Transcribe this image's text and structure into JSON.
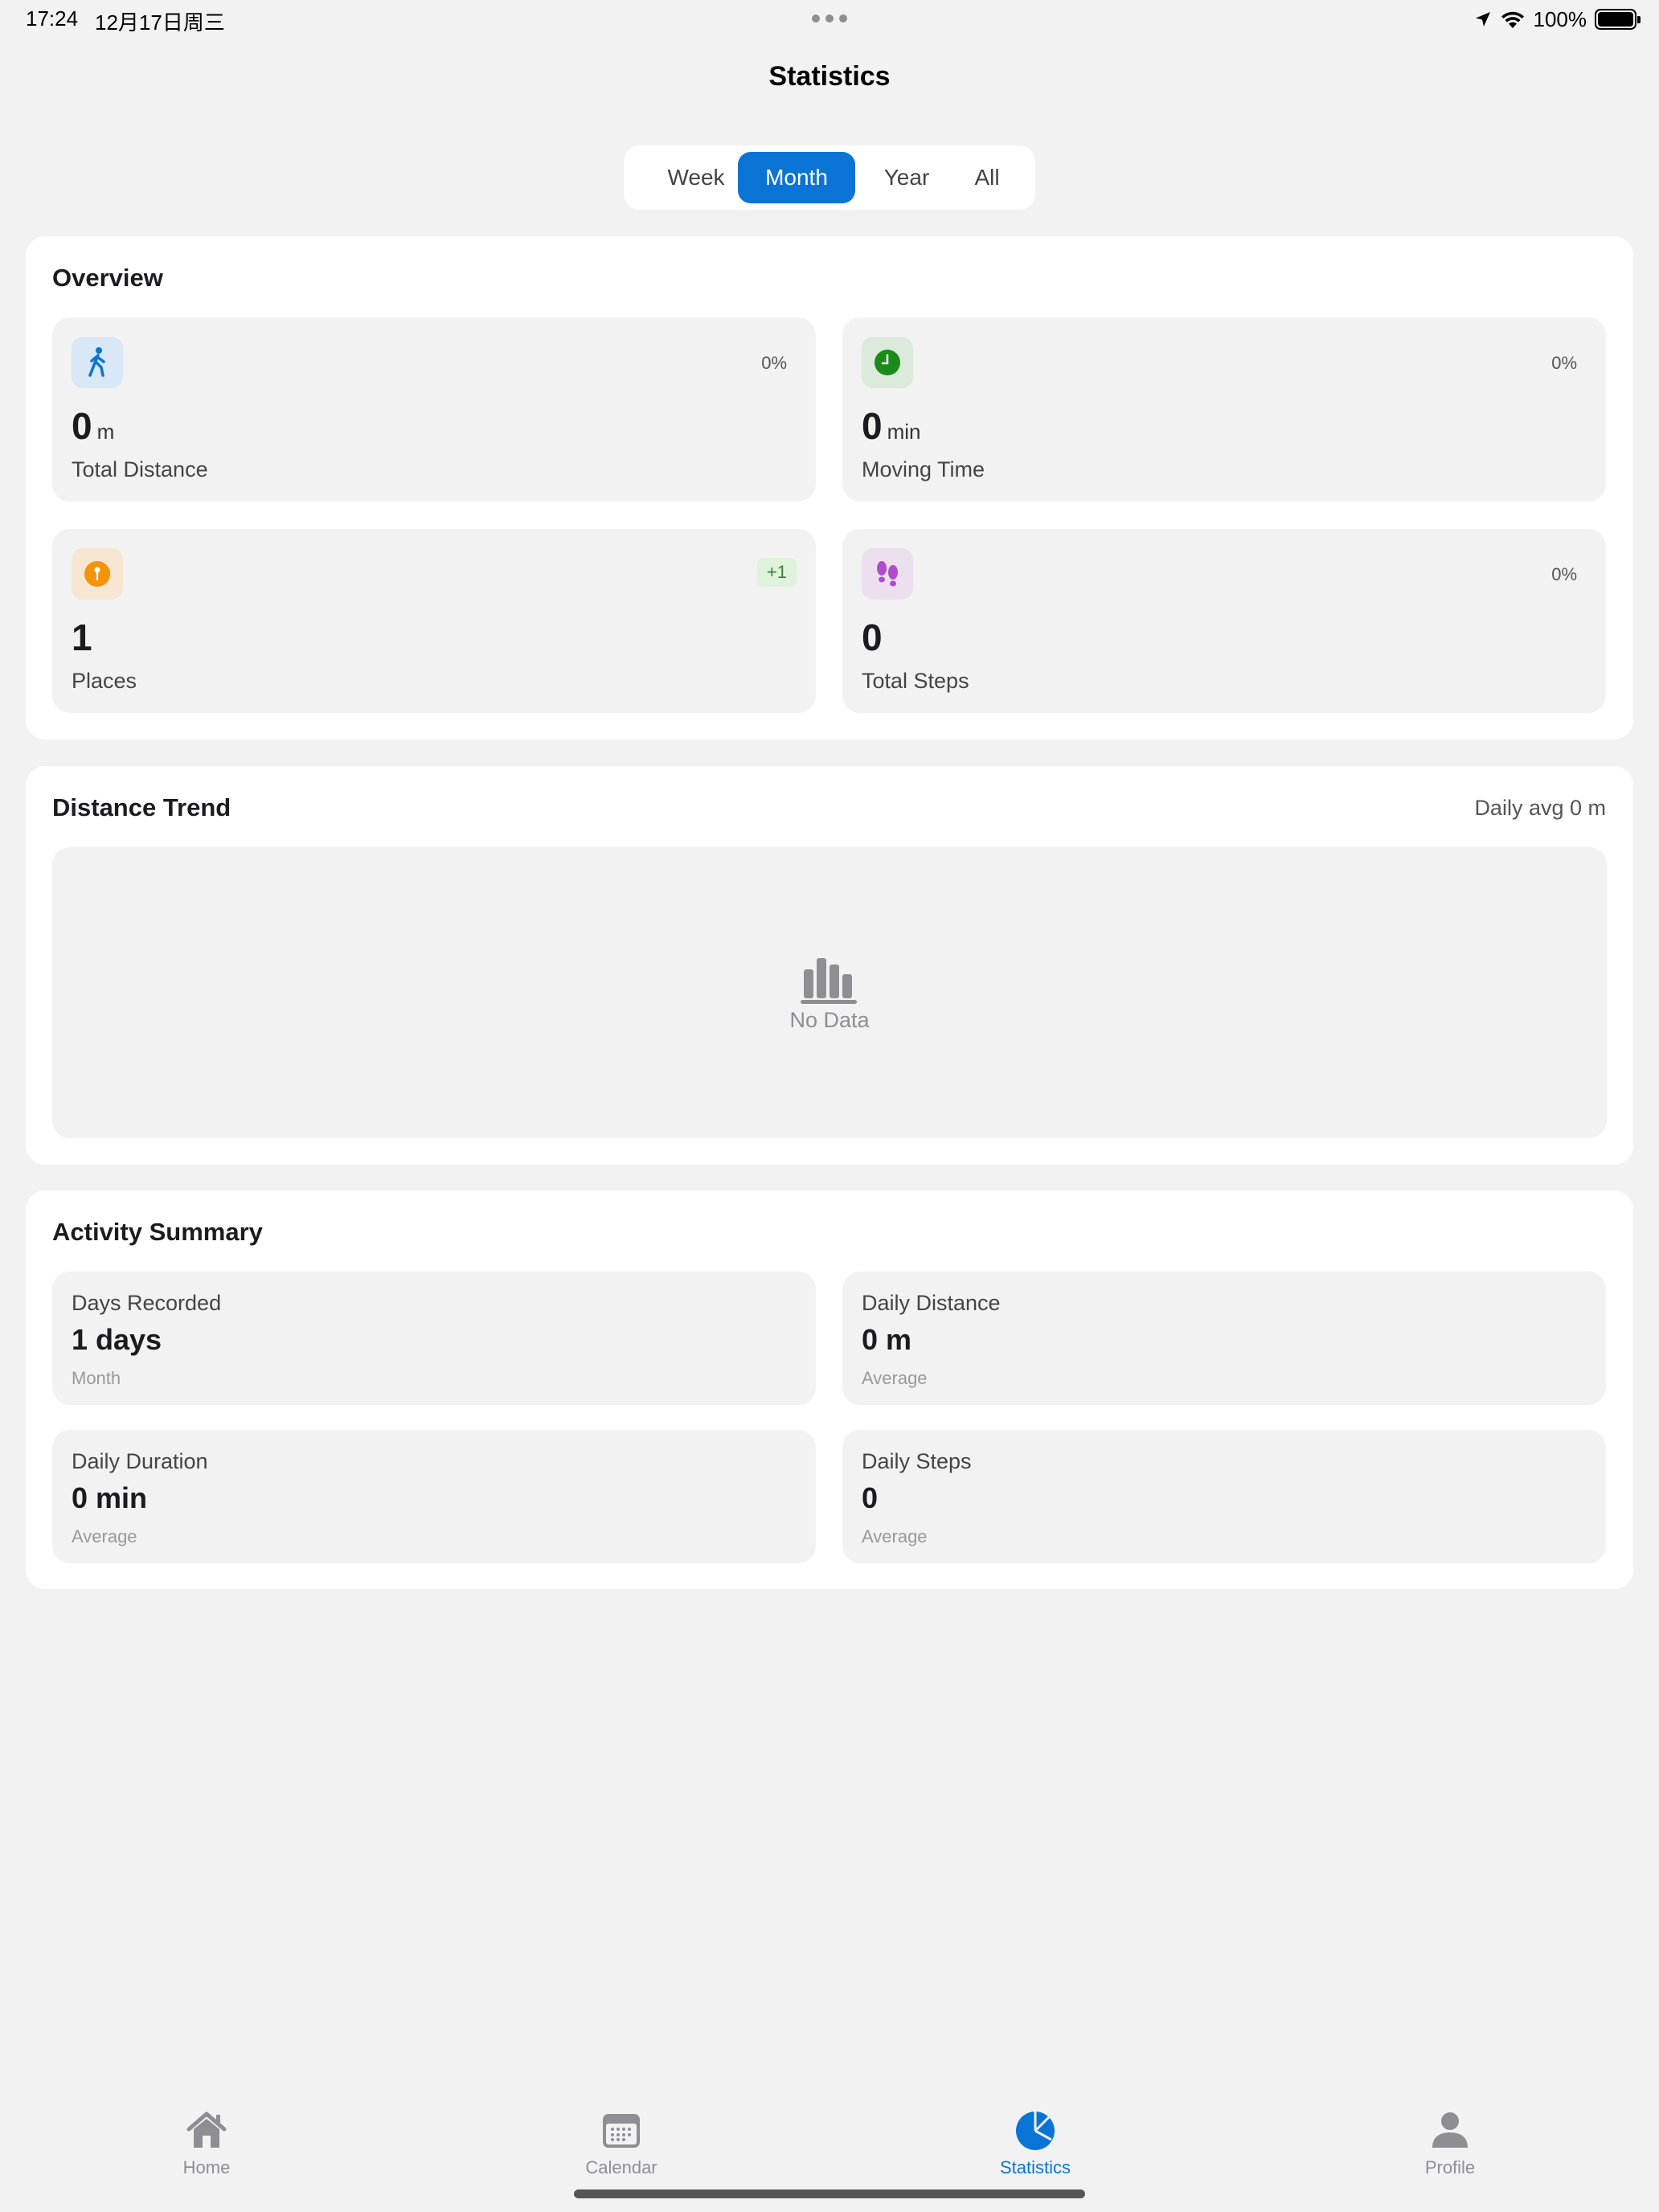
{
  "status_bar": {
    "time": "17:24",
    "date": "12月17日周三",
    "battery": "100%"
  },
  "header": {
    "title": "Statistics"
  },
  "period_tabs": [
    {
      "label": "Week",
      "active": false
    },
    {
      "label": "Month",
      "active": true
    },
    {
      "label": "Year",
      "active": false
    },
    {
      "label": "All",
      "active": false
    }
  ],
  "overview": {
    "title": "Overview",
    "tiles": [
      {
        "value": "0",
        "unit": "m",
        "label": "Total Distance",
        "change": "0%",
        "icon": "walking-icon",
        "icon_bg": "#d8e8f6",
        "icon_color": "#0a74d6"
      },
      {
        "value": "0",
        "unit": "min",
        "label": "Moving Time",
        "change": "0%",
        "icon": "clock-icon",
        "icon_bg": "#dbeadb",
        "icon_color": "#1a8a1a"
      },
      {
        "value": "1",
        "unit": "",
        "label": "Places",
        "change": "+1",
        "icon": "location-pin-icon",
        "icon_bg": "#f6e6d2",
        "icon_color": "#f5930a"
      },
      {
        "value": "0",
        "unit": "",
        "label": "Total Steps",
        "change": "0%",
        "icon": "footprints-icon",
        "icon_bg": "#ece0ef",
        "icon_color": "#b04ccf"
      }
    ]
  },
  "distance_trend": {
    "title": "Distance Trend",
    "daily_avg": "Daily avg 0 m",
    "empty_text": "No Data"
  },
  "activity_summary": {
    "title": "Activity Summary",
    "items": [
      {
        "label": "Days Recorded",
        "value": "1 days",
        "sub": "Month"
      },
      {
        "label": "Daily Distance",
        "value": "0 m",
        "sub": "Average"
      },
      {
        "label": "Daily Duration",
        "value": "0 min",
        "sub": "Average"
      },
      {
        "label": "Daily Steps",
        "value": "0",
        "sub": "Average"
      }
    ]
  },
  "tab_bar": [
    {
      "label": "Home",
      "icon": "house-icon",
      "active": false
    },
    {
      "label": "Calendar",
      "icon": "calendar-icon",
      "active": false
    },
    {
      "label": "Statistics",
      "icon": "pie-chart-icon",
      "active": true
    },
    {
      "label": "Profile",
      "icon": "person-icon",
      "active": false
    }
  ],
  "colors": {
    "accent": "#0a74d6",
    "background": "#f2f2f2",
    "card": "#ffffff",
    "tile": "#f2f2f2"
  }
}
